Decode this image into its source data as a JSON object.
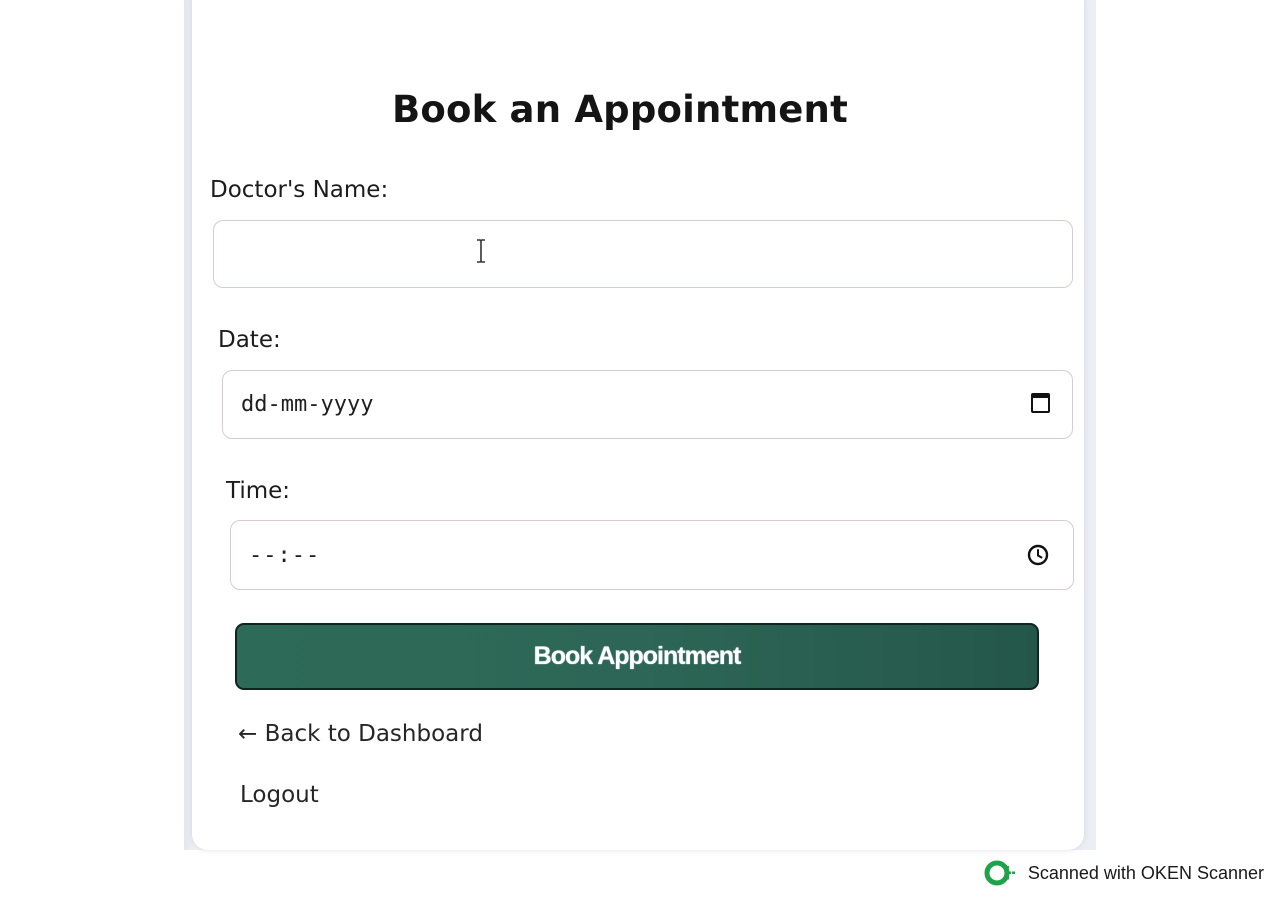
{
  "page": {
    "title": "Book an Appointment"
  },
  "form": {
    "doctor_label": "Doctor's Name:",
    "doctor_value": "",
    "date_label": "Date:",
    "date_placeholder": "dd-mm-yyyy",
    "time_label": "Time:",
    "time_placeholder": "--:--",
    "submit_label": "Book Appointment"
  },
  "links": {
    "back": "← Back to Dashboard",
    "logout": "Logout"
  },
  "watermark": {
    "text": "Scanned with OKEN Scanner"
  },
  "colors": {
    "button_bg": "#2d6656",
    "watermark_green": "#1fa24a"
  },
  "icons": {
    "date": "calendar-icon",
    "time": "clock-icon",
    "cursor": "text-cursor-icon"
  }
}
